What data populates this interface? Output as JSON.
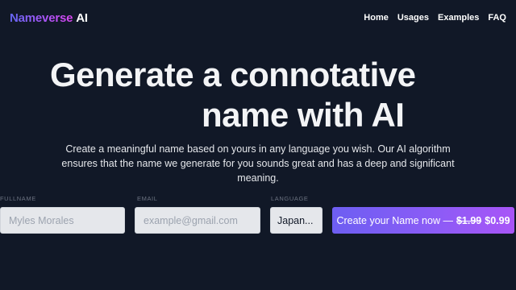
{
  "header": {
    "logo_brand": "Nameverse",
    "logo_suffix": "AI",
    "nav": [
      {
        "label": "Home"
      },
      {
        "label": "Usages"
      },
      {
        "label": "Examples"
      },
      {
        "label": "FAQ"
      }
    ]
  },
  "hero": {
    "title_line1": "Generate a connotative",
    "title_line2": "name with AI",
    "subtitle": "Create a meaningful name based on yours in any language you wish. Our AI algorithm ensures that the name we generate for you sounds great and has a deep and significant meaning."
  },
  "form": {
    "fullname": {
      "label": "FULLNAME",
      "placeholder": "Myles Morales",
      "value": ""
    },
    "email": {
      "label": "EMAIL",
      "placeholder": "example@gmail.com",
      "value": ""
    },
    "language": {
      "label": "LANGUAGE",
      "selected": "Japan..."
    },
    "cta": {
      "label": "Create your Name now —",
      "old_price": "$1.99",
      "price": "$0.99"
    }
  },
  "colors": {
    "background": "#111827",
    "accent_start": "#6366f1",
    "accent_end": "#a855f7"
  }
}
